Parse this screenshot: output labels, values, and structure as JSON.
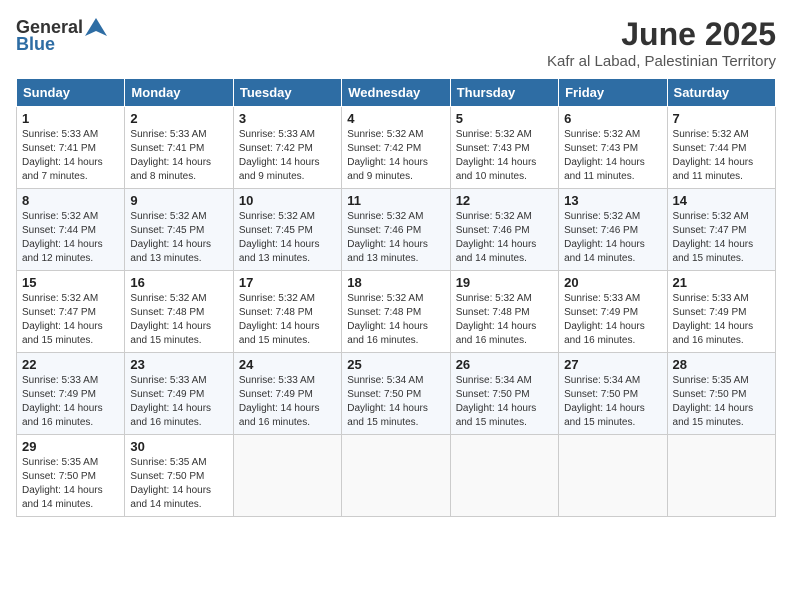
{
  "logo": {
    "general": "General",
    "blue": "Blue"
  },
  "title": {
    "month": "June 2025",
    "location": "Kafr al Labad, Palestinian Territory"
  },
  "headers": [
    "Sunday",
    "Monday",
    "Tuesday",
    "Wednesday",
    "Thursday",
    "Friday",
    "Saturday"
  ],
  "weeks": [
    [
      {
        "day": "1",
        "sunrise": "Sunrise: 5:33 AM",
        "sunset": "Sunset: 7:41 PM",
        "daylight": "Daylight: 14 hours and 7 minutes."
      },
      {
        "day": "2",
        "sunrise": "Sunrise: 5:33 AM",
        "sunset": "Sunset: 7:41 PM",
        "daylight": "Daylight: 14 hours and 8 minutes."
      },
      {
        "day": "3",
        "sunrise": "Sunrise: 5:33 AM",
        "sunset": "Sunset: 7:42 PM",
        "daylight": "Daylight: 14 hours and 9 minutes."
      },
      {
        "day": "4",
        "sunrise": "Sunrise: 5:32 AM",
        "sunset": "Sunset: 7:42 PM",
        "daylight": "Daylight: 14 hours and 9 minutes."
      },
      {
        "day": "5",
        "sunrise": "Sunrise: 5:32 AM",
        "sunset": "Sunset: 7:43 PM",
        "daylight": "Daylight: 14 hours and 10 minutes."
      },
      {
        "day": "6",
        "sunrise": "Sunrise: 5:32 AM",
        "sunset": "Sunset: 7:43 PM",
        "daylight": "Daylight: 14 hours and 11 minutes."
      },
      {
        "day": "7",
        "sunrise": "Sunrise: 5:32 AM",
        "sunset": "Sunset: 7:44 PM",
        "daylight": "Daylight: 14 hours and 11 minutes."
      }
    ],
    [
      {
        "day": "8",
        "sunrise": "Sunrise: 5:32 AM",
        "sunset": "Sunset: 7:44 PM",
        "daylight": "Daylight: 14 hours and 12 minutes."
      },
      {
        "day": "9",
        "sunrise": "Sunrise: 5:32 AM",
        "sunset": "Sunset: 7:45 PM",
        "daylight": "Daylight: 14 hours and 13 minutes."
      },
      {
        "day": "10",
        "sunrise": "Sunrise: 5:32 AM",
        "sunset": "Sunset: 7:45 PM",
        "daylight": "Daylight: 14 hours and 13 minutes."
      },
      {
        "day": "11",
        "sunrise": "Sunrise: 5:32 AM",
        "sunset": "Sunset: 7:46 PM",
        "daylight": "Daylight: 14 hours and 13 minutes."
      },
      {
        "day": "12",
        "sunrise": "Sunrise: 5:32 AM",
        "sunset": "Sunset: 7:46 PM",
        "daylight": "Daylight: 14 hours and 14 minutes."
      },
      {
        "day": "13",
        "sunrise": "Sunrise: 5:32 AM",
        "sunset": "Sunset: 7:46 PM",
        "daylight": "Daylight: 14 hours and 14 minutes."
      },
      {
        "day": "14",
        "sunrise": "Sunrise: 5:32 AM",
        "sunset": "Sunset: 7:47 PM",
        "daylight": "Daylight: 14 hours and 15 minutes."
      }
    ],
    [
      {
        "day": "15",
        "sunrise": "Sunrise: 5:32 AM",
        "sunset": "Sunset: 7:47 PM",
        "daylight": "Daylight: 14 hours and 15 minutes."
      },
      {
        "day": "16",
        "sunrise": "Sunrise: 5:32 AM",
        "sunset": "Sunset: 7:48 PM",
        "daylight": "Daylight: 14 hours and 15 minutes."
      },
      {
        "day": "17",
        "sunrise": "Sunrise: 5:32 AM",
        "sunset": "Sunset: 7:48 PM",
        "daylight": "Daylight: 14 hours and 15 minutes."
      },
      {
        "day": "18",
        "sunrise": "Sunrise: 5:32 AM",
        "sunset": "Sunset: 7:48 PM",
        "daylight": "Daylight: 14 hours and 16 minutes."
      },
      {
        "day": "19",
        "sunrise": "Sunrise: 5:32 AM",
        "sunset": "Sunset: 7:48 PM",
        "daylight": "Daylight: 14 hours and 16 minutes."
      },
      {
        "day": "20",
        "sunrise": "Sunrise: 5:33 AM",
        "sunset": "Sunset: 7:49 PM",
        "daylight": "Daylight: 14 hours and 16 minutes."
      },
      {
        "day": "21",
        "sunrise": "Sunrise: 5:33 AM",
        "sunset": "Sunset: 7:49 PM",
        "daylight": "Daylight: 14 hours and 16 minutes."
      }
    ],
    [
      {
        "day": "22",
        "sunrise": "Sunrise: 5:33 AM",
        "sunset": "Sunset: 7:49 PM",
        "daylight": "Daylight: 14 hours and 16 minutes."
      },
      {
        "day": "23",
        "sunrise": "Sunrise: 5:33 AM",
        "sunset": "Sunset: 7:49 PM",
        "daylight": "Daylight: 14 hours and 16 minutes."
      },
      {
        "day": "24",
        "sunrise": "Sunrise: 5:33 AM",
        "sunset": "Sunset: 7:49 PM",
        "daylight": "Daylight: 14 hours and 16 minutes."
      },
      {
        "day": "25",
        "sunrise": "Sunrise: 5:34 AM",
        "sunset": "Sunset: 7:50 PM",
        "daylight": "Daylight: 14 hours and 15 minutes."
      },
      {
        "day": "26",
        "sunrise": "Sunrise: 5:34 AM",
        "sunset": "Sunset: 7:50 PM",
        "daylight": "Daylight: 14 hours and 15 minutes."
      },
      {
        "day": "27",
        "sunrise": "Sunrise: 5:34 AM",
        "sunset": "Sunset: 7:50 PM",
        "daylight": "Daylight: 14 hours and 15 minutes."
      },
      {
        "day": "28",
        "sunrise": "Sunrise: 5:35 AM",
        "sunset": "Sunset: 7:50 PM",
        "daylight": "Daylight: 14 hours and 15 minutes."
      }
    ],
    [
      {
        "day": "29",
        "sunrise": "Sunrise: 5:35 AM",
        "sunset": "Sunset: 7:50 PM",
        "daylight": "Daylight: 14 hours and 14 minutes."
      },
      {
        "day": "30",
        "sunrise": "Sunrise: 5:35 AM",
        "sunset": "Sunset: 7:50 PM",
        "daylight": "Daylight: 14 hours and 14 minutes."
      },
      null,
      null,
      null,
      null,
      null
    ]
  ]
}
